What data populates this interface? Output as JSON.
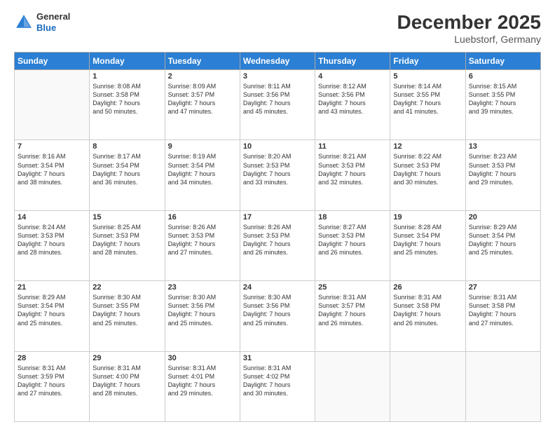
{
  "logo": {
    "general": "General",
    "blue": "Blue"
  },
  "title": "December 2025",
  "subtitle": "Luebstorf, Germany",
  "headers": [
    "Sunday",
    "Monday",
    "Tuesday",
    "Wednesday",
    "Thursday",
    "Friday",
    "Saturday"
  ],
  "weeks": [
    [
      {
        "day": "",
        "info": ""
      },
      {
        "day": "1",
        "info": "Sunrise: 8:08 AM\nSunset: 3:58 PM\nDaylight: 7 hours\nand 50 minutes."
      },
      {
        "day": "2",
        "info": "Sunrise: 8:09 AM\nSunset: 3:57 PM\nDaylight: 7 hours\nand 47 minutes."
      },
      {
        "day": "3",
        "info": "Sunrise: 8:11 AM\nSunset: 3:56 PM\nDaylight: 7 hours\nand 45 minutes."
      },
      {
        "day": "4",
        "info": "Sunrise: 8:12 AM\nSunset: 3:56 PM\nDaylight: 7 hours\nand 43 minutes."
      },
      {
        "day": "5",
        "info": "Sunrise: 8:14 AM\nSunset: 3:55 PM\nDaylight: 7 hours\nand 41 minutes."
      },
      {
        "day": "6",
        "info": "Sunrise: 8:15 AM\nSunset: 3:55 PM\nDaylight: 7 hours\nand 39 minutes."
      }
    ],
    [
      {
        "day": "7",
        "info": "Sunrise: 8:16 AM\nSunset: 3:54 PM\nDaylight: 7 hours\nand 38 minutes."
      },
      {
        "day": "8",
        "info": "Sunrise: 8:17 AM\nSunset: 3:54 PM\nDaylight: 7 hours\nand 36 minutes."
      },
      {
        "day": "9",
        "info": "Sunrise: 8:19 AM\nSunset: 3:54 PM\nDaylight: 7 hours\nand 34 minutes."
      },
      {
        "day": "10",
        "info": "Sunrise: 8:20 AM\nSunset: 3:53 PM\nDaylight: 7 hours\nand 33 minutes."
      },
      {
        "day": "11",
        "info": "Sunrise: 8:21 AM\nSunset: 3:53 PM\nDaylight: 7 hours\nand 32 minutes."
      },
      {
        "day": "12",
        "info": "Sunrise: 8:22 AM\nSunset: 3:53 PM\nDaylight: 7 hours\nand 30 minutes."
      },
      {
        "day": "13",
        "info": "Sunrise: 8:23 AM\nSunset: 3:53 PM\nDaylight: 7 hours\nand 29 minutes."
      }
    ],
    [
      {
        "day": "14",
        "info": "Sunrise: 8:24 AM\nSunset: 3:53 PM\nDaylight: 7 hours\nand 28 minutes."
      },
      {
        "day": "15",
        "info": "Sunrise: 8:25 AM\nSunset: 3:53 PM\nDaylight: 7 hours\nand 28 minutes."
      },
      {
        "day": "16",
        "info": "Sunrise: 8:26 AM\nSunset: 3:53 PM\nDaylight: 7 hours\nand 27 minutes."
      },
      {
        "day": "17",
        "info": "Sunrise: 8:26 AM\nSunset: 3:53 PM\nDaylight: 7 hours\nand 26 minutes."
      },
      {
        "day": "18",
        "info": "Sunrise: 8:27 AM\nSunset: 3:53 PM\nDaylight: 7 hours\nand 26 minutes."
      },
      {
        "day": "19",
        "info": "Sunrise: 8:28 AM\nSunset: 3:54 PM\nDaylight: 7 hours\nand 25 minutes."
      },
      {
        "day": "20",
        "info": "Sunrise: 8:29 AM\nSunset: 3:54 PM\nDaylight: 7 hours\nand 25 minutes."
      }
    ],
    [
      {
        "day": "21",
        "info": "Sunrise: 8:29 AM\nSunset: 3:54 PM\nDaylight: 7 hours\nand 25 minutes."
      },
      {
        "day": "22",
        "info": "Sunrise: 8:30 AM\nSunset: 3:55 PM\nDaylight: 7 hours\nand 25 minutes."
      },
      {
        "day": "23",
        "info": "Sunrise: 8:30 AM\nSunset: 3:56 PM\nDaylight: 7 hours\nand 25 minutes."
      },
      {
        "day": "24",
        "info": "Sunrise: 8:30 AM\nSunset: 3:56 PM\nDaylight: 7 hours\nand 25 minutes."
      },
      {
        "day": "25",
        "info": "Sunrise: 8:31 AM\nSunset: 3:57 PM\nDaylight: 7 hours\nand 26 minutes."
      },
      {
        "day": "26",
        "info": "Sunrise: 8:31 AM\nSunset: 3:58 PM\nDaylight: 7 hours\nand 26 minutes."
      },
      {
        "day": "27",
        "info": "Sunrise: 8:31 AM\nSunset: 3:58 PM\nDaylight: 7 hours\nand 27 minutes."
      }
    ],
    [
      {
        "day": "28",
        "info": "Sunrise: 8:31 AM\nSunset: 3:59 PM\nDaylight: 7 hours\nand 27 minutes."
      },
      {
        "day": "29",
        "info": "Sunrise: 8:31 AM\nSunset: 4:00 PM\nDaylight: 7 hours\nand 28 minutes."
      },
      {
        "day": "30",
        "info": "Sunrise: 8:31 AM\nSunset: 4:01 PM\nDaylight: 7 hours\nand 29 minutes."
      },
      {
        "day": "31",
        "info": "Sunrise: 8:31 AM\nSunset: 4:02 PM\nDaylight: 7 hours\nand 30 minutes."
      },
      {
        "day": "",
        "info": ""
      },
      {
        "day": "",
        "info": ""
      },
      {
        "day": "",
        "info": ""
      }
    ]
  ]
}
